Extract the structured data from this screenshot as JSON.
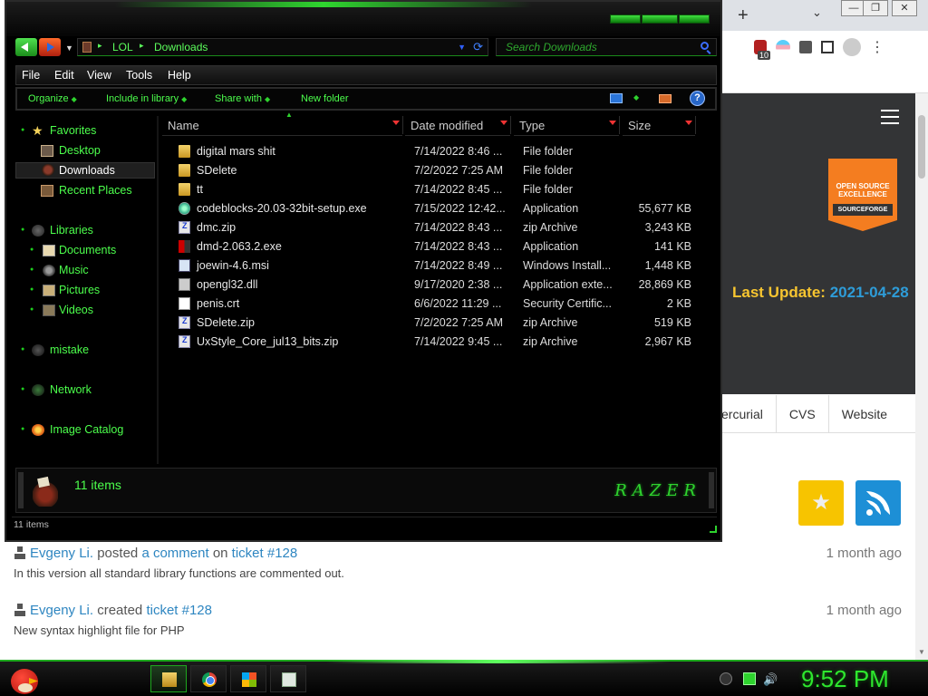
{
  "explorer": {
    "breadcrumb": [
      "LOL",
      "Downloads"
    ],
    "search_placeholder": "Search Downloads",
    "menu": [
      "File",
      "Edit",
      "View",
      "Tools",
      "Help"
    ],
    "commands": [
      "Organize",
      "Include in library",
      "Share with",
      "New folder"
    ],
    "help_label": "?",
    "nav": {
      "favorites": "Favorites",
      "desktop": "Desktop",
      "downloads": "Downloads",
      "recent": "Recent Places",
      "libraries": "Libraries",
      "documents": "Documents",
      "music": "Music",
      "pictures": "Pictures",
      "videos": "Videos",
      "mistake": "mistake",
      "network": "Network",
      "image_catalog": "Image Catalog"
    },
    "columns": [
      "Name",
      "Date modified",
      "Type",
      "Size"
    ],
    "files": [
      {
        "name": "digital mars shit",
        "date": "7/14/2022 8:46 ...",
        "type": "File folder",
        "size": "",
        "icon": "folder-icon"
      },
      {
        "name": "SDelete",
        "date": "7/2/2022 7:25 AM",
        "type": "File folder",
        "size": "",
        "icon": "folder-icon"
      },
      {
        "name": "tt",
        "date": "7/14/2022 8:45 ...",
        "type": "File folder",
        "size": "",
        "icon": "folder-icon"
      },
      {
        "name": "codeblocks-20.03-32bit-setup.exe",
        "date": "7/15/2022 12:42...",
        "type": "Application",
        "size": "55,677 KB",
        "icon": "codeblocks-icon"
      },
      {
        "name": "dmc.zip",
        "date": "7/14/2022 8:43 ...",
        "type": "zip Archive",
        "size": "3,243 KB",
        "icon": "zip-icon"
      },
      {
        "name": "dmd-2.063.2.exe",
        "date": "7/14/2022 8:43 ...",
        "type": "Application",
        "size": "141 KB",
        "icon": "dmd-icon"
      },
      {
        "name": "joewin-4.6.msi",
        "date": "7/14/2022 8:49 ...",
        "type": "Windows Install...",
        "size": "1,448 KB",
        "icon": "msi-icon"
      },
      {
        "name": "opengl32.dll",
        "date": "9/17/2020 2:38 ...",
        "type": "Application exte...",
        "size": "28,869 KB",
        "icon": "dll-icon"
      },
      {
        "name": "penis.crt",
        "date": "6/6/2022 11:29 ...",
        "type": "Security Certific...",
        "size": "2 KB",
        "icon": "certificate-icon"
      },
      {
        "name": "SDelete.zip",
        "date": "7/2/2022 7:25 AM",
        "type": "zip Archive",
        "size": "519 KB",
        "icon": "zip-icon"
      },
      {
        "name": "UxStyle_Core_jul13_bits.zip",
        "date": "7/14/2022 9:45 ...",
        "type": "zip Archive",
        "size": "2,967 KB",
        "icon": "zip-icon"
      }
    ],
    "details_count": "11 items",
    "details_logo": "RAZER",
    "status_text": "11 items"
  },
  "browser": {
    "extension_badge": "10",
    "last_update_label": "Last Update:",
    "last_update_date": "2021-04-28",
    "badge_line1": "OPEN SOURCE",
    "badge_line2": "EXCELLENCE",
    "badge_sf": "SOURCEFORGE",
    "tabs": [
      "ercurial",
      "CVS",
      "Website"
    ],
    "activity": [
      {
        "user": "Evgeny Li.",
        "verb": "posted",
        "object": "a comment",
        "prep": "on",
        "ticket": "ticket #128",
        "time": "1 month ago",
        "detail": "In this version all standard library functions are commented out."
      },
      {
        "user": "Evgeny Li.",
        "verb": "created",
        "object": "",
        "prep": "",
        "ticket": "ticket #128",
        "time": "1 month ago",
        "detail": "New syntax highlight file for PHP"
      }
    ]
  },
  "taskbar": {
    "clock": "9:52 PM"
  },
  "colors": {
    "accent_green": "#4cff4c",
    "explorer_bg": "#000000",
    "link_blue": "#2e86c1",
    "update_yellow": "#f7c530"
  }
}
